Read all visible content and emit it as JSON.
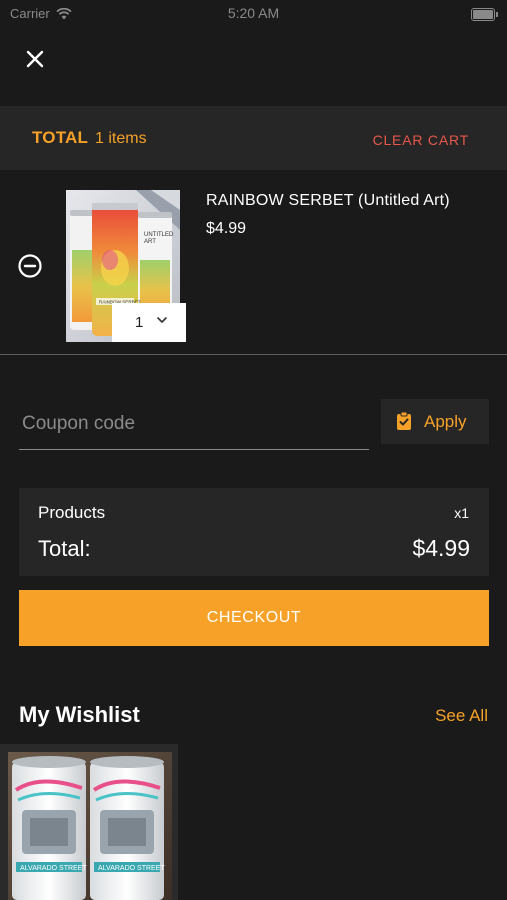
{
  "status_bar": {
    "carrier": "Carrier",
    "time": "5:20 AM"
  },
  "header": {
    "close_icon": "close-icon"
  },
  "cart_header": {
    "total_label": "TOTAL",
    "items_count": "1 items",
    "clear_cart_label": "CLEAR CART"
  },
  "cart_items": [
    {
      "name": "RAINBOW SERBET (Untitled Art)",
      "price": "$4.99",
      "quantity": "1",
      "image_label": "UNTITLED ART",
      "image_sublabel": "RAINBOW SERBET"
    }
  ],
  "coupon": {
    "placeholder": "Coupon code",
    "apply_label": "Apply"
  },
  "summary": {
    "products_label": "Products",
    "products_qty": "x1",
    "total_label": "Total:",
    "total_value": "$4.99"
  },
  "checkout": {
    "label": "CHECKOUT"
  },
  "wishlist": {
    "title": "My Wishlist",
    "see_all_label": "See All"
  },
  "colors": {
    "background": "#1a1a1a",
    "panel": "#262626",
    "accent": "#f7a128",
    "danger": "#e8574a"
  }
}
